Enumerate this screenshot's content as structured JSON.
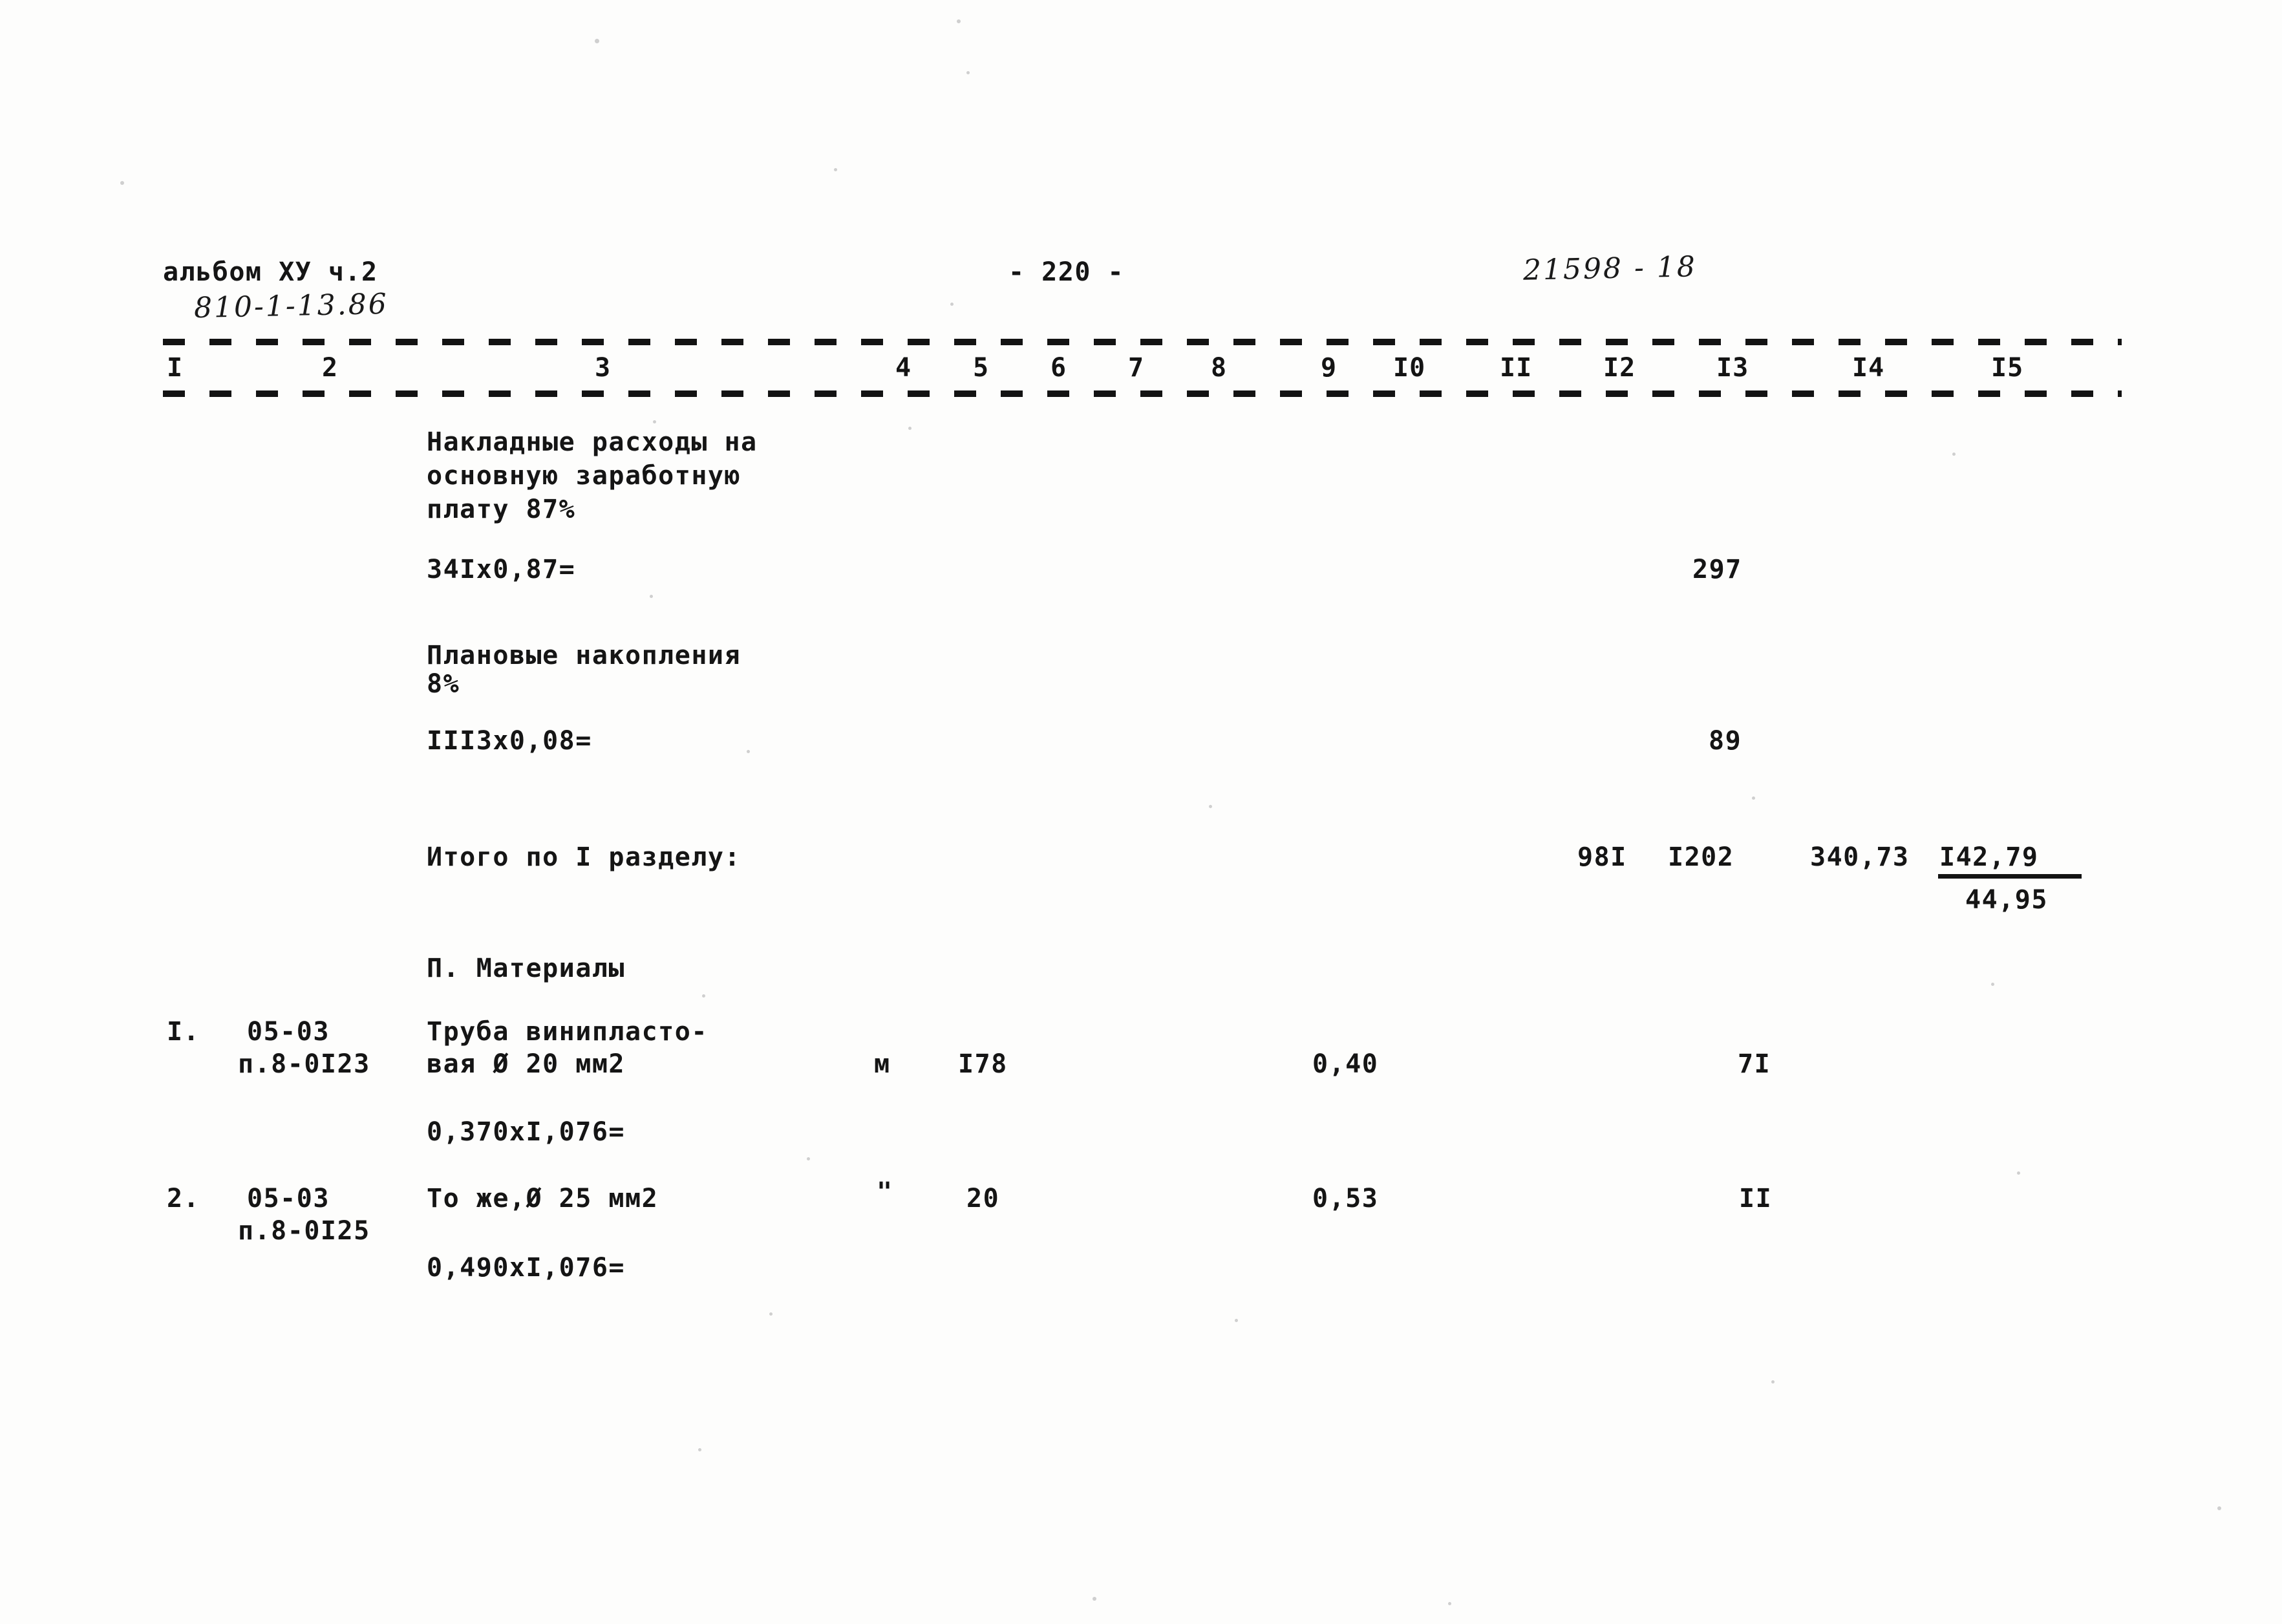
{
  "document": {
    "album_label": "альбом ХУ ч.2",
    "album_code_handwritten": "810-1-13.86",
    "page_number": "- 220 -",
    "archive_code_handwritten": "21598 - 18"
  },
  "table": {
    "column_headers": [
      "I",
      "2",
      "3",
      "4",
      "5",
      "6",
      "7",
      "8",
      "9",
      "I0",
      "II",
      "I2",
      "I3",
      "I4",
      "I5"
    ],
    "rows": [
      {
        "id": "overhead-block",
        "description_lines": [
          "Накладные расходы на",
          "основную заработную",
          "плату 87%"
        ]
      },
      {
        "id": "overhead-calc",
        "formula": "34Ix0,87=",
        "col13": "297"
      },
      {
        "id": "planned-savings-block",
        "description_lines": [
          "Плановые накопления",
          "8%"
        ]
      },
      {
        "id": "planned-savings-calc",
        "formula": "III3x0,08=",
        "col13": "89"
      },
      {
        "id": "section-total",
        "label": "Итого по I разделу:",
        "col12": "98I",
        "col13": "I202",
        "col14": "340,73",
        "col15_top": "I42,79",
        "col15_bottom": "44,95"
      },
      {
        "id": "section-heading-materials",
        "heading": "П. Материалы"
      },
      {
        "id": "material-1",
        "num": "I.",
        "code_line1": "05-03",
        "code_line2": "п.8-0I23",
        "name_line1": "Труба винипласто-",
        "name_line2": "вая Ø 20 мм2",
        "unit": "м",
        "qty": "I78",
        "price": "0,40",
        "col13": "7I",
        "formula": "0,370xI,076="
      },
      {
        "id": "material-2",
        "num": "2.",
        "code_line1": "05-03",
        "code_line2": "п.8-0I25",
        "name_line1": "То же,Ø 25 мм2",
        "unit": "\"",
        "qty": "20",
        "price": "0,53",
        "col13": "II",
        "formula": "0,490xI,076="
      }
    ]
  }
}
